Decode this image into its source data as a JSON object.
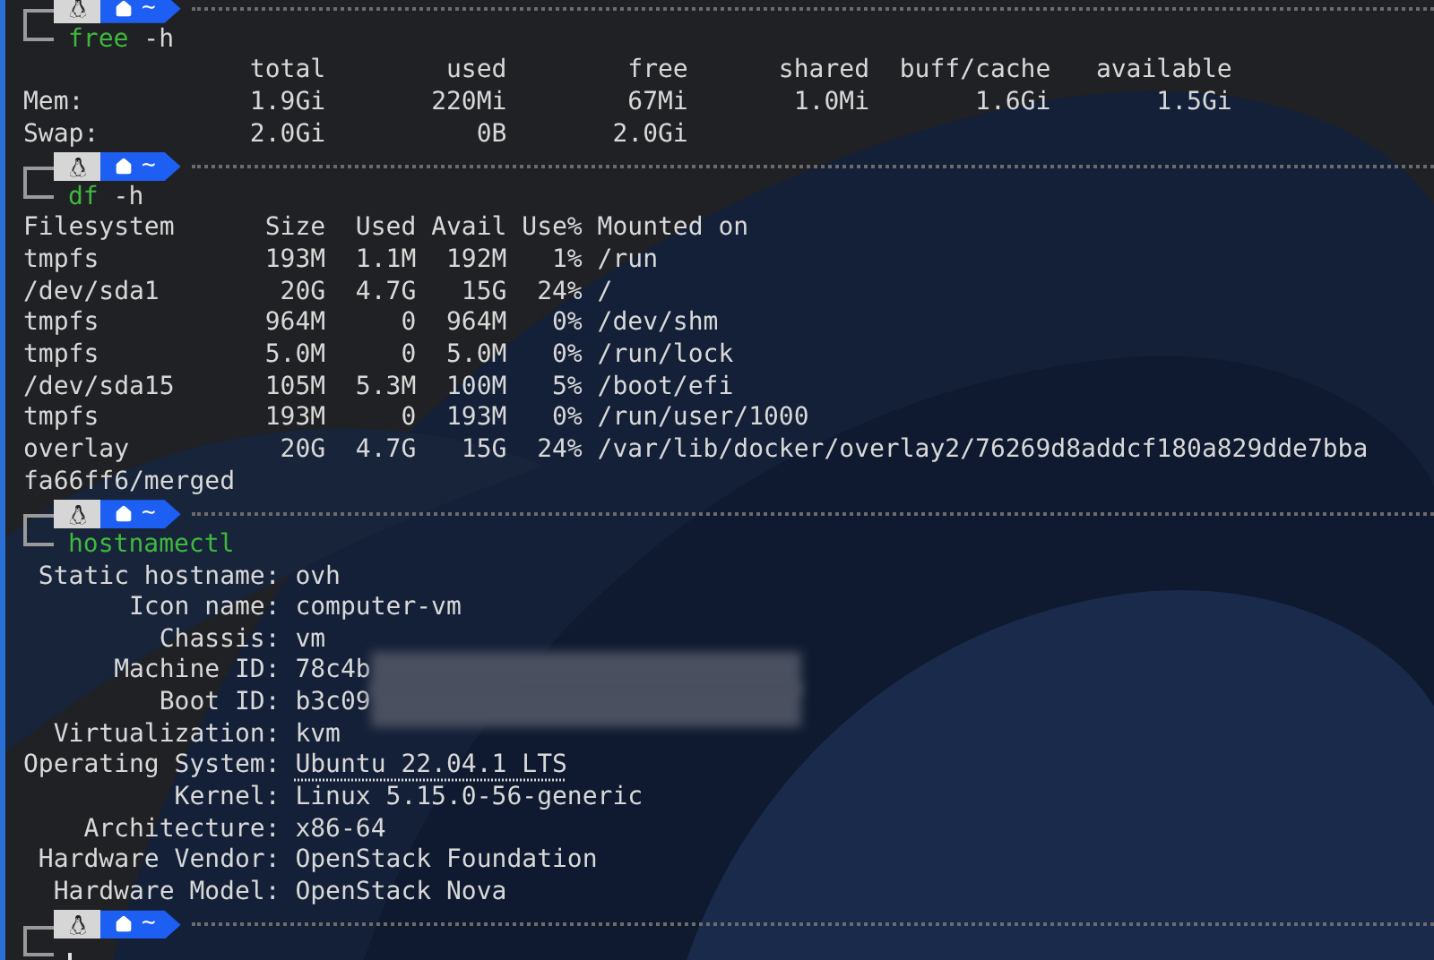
{
  "blocks": [
    {
      "prompt": {
        "dir": "~"
      },
      "command": {
        "name": "free",
        "args": "-h"
      },
      "output": {
        "kind": "lines",
        "lines": [
          "               total        used        free      shared  buff/cache   available",
          "Mem:           1.9Gi       220Mi        67Mi       1.0Mi       1.6Gi       1.5Gi",
          "Swap:          2.0Gi          0B       2.0Gi"
        ]
      }
    },
    {
      "prompt": {
        "dir": "~"
      },
      "command": {
        "name": "df",
        "args": "-h"
      },
      "output": {
        "kind": "lines",
        "lines": [
          "Filesystem      Size  Used Avail Use% Mounted on",
          "tmpfs           193M  1.1M  192M   1% /run",
          "/dev/sda1        20G  4.7G   15G  24% /",
          "tmpfs           964M     0  964M   0% /dev/shm",
          "tmpfs           5.0M     0  5.0M   0% /run/lock",
          "/dev/sda15      105M  5.3M  100M   5% /boot/efi",
          "tmpfs           193M     0  193M   0% /run/user/1000",
          "overlay          20G  4.7G   15G  24% /var/lib/docker/overlay2/76269d8addcf180a829dde7bba",
          "fa66ff6/merged"
        ]
      }
    },
    {
      "prompt": {
        "dir": "~"
      },
      "command": {
        "name": "hostnamectl"
      },
      "output": {
        "kind": "fields",
        "fields": [
          {
            "label": "Static hostname:",
            "value": "ovh",
            "link": false,
            "redacted": false
          },
          {
            "label": "Icon name:",
            "value": "computer-vm",
            "link": false,
            "redacted": false
          },
          {
            "label": "Chassis:",
            "value": "vm",
            "link": false,
            "redacted": false
          },
          {
            "label": "Machine ID:",
            "value": "78c4b",
            "link": false,
            "redacted": true
          },
          {
            "label": "Boot ID:",
            "value": "b3c09",
            "link": false,
            "redacted": true
          },
          {
            "label": "Virtualization:",
            "value": "kvm",
            "link": false,
            "redacted": false
          },
          {
            "label": "Operating System:",
            "value": "Ubuntu 22.04.1 LTS",
            "link": true,
            "redacted": false
          },
          {
            "label": "Kernel:",
            "value": "Linux 5.15.0-56-generic",
            "link": false,
            "redacted": false
          },
          {
            "label": "Architecture:",
            "value": "x86-64",
            "link": false,
            "redacted": false
          },
          {
            "label": "Hardware Vendor:",
            "value": "OpenStack Foundation",
            "link": false,
            "redacted": false
          },
          {
            "label": "Hardware Model:",
            "value": "OpenStack Nova",
            "link": false,
            "redacted": false
          }
        ]
      }
    }
  ],
  "final_prompt": {
    "dir": "~"
  }
}
